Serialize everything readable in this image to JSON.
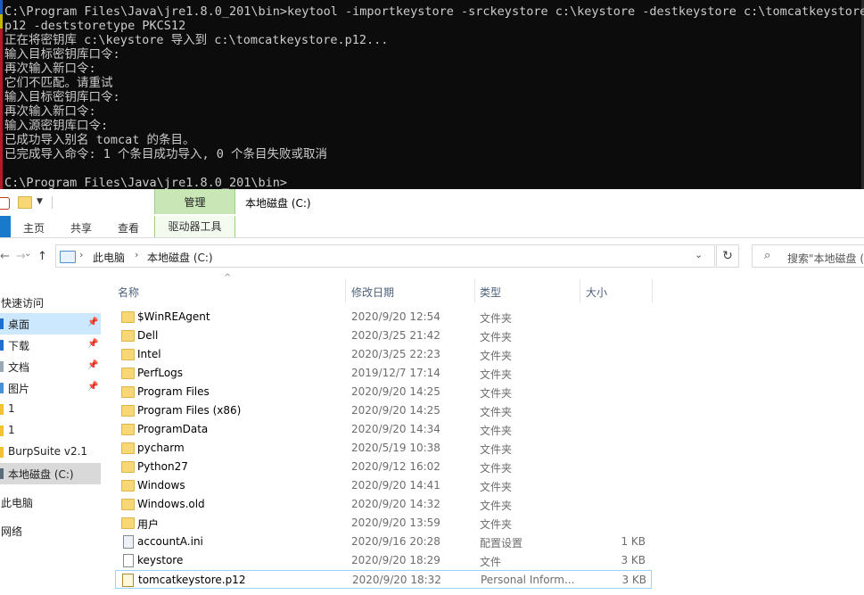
{
  "console": {
    "lines": [
      "C:\\Program Files\\Java\\jre1.8.0_201\\bin>keytool -importkeystore -srckeystore c:\\keystore -destkeystore c:\\tomcatkeystore.",
      "p12 -deststoretype PKCS12",
      "正在将密钥库 c:\\keystore 导入到 c:\\tomcatkeystore.p12...",
      "输入目标密钥库口令:",
      "再次输入新口令:",
      "它们不匹配。请重试",
      "输入目标密钥库口令:",
      "再次输入新口令:",
      "输入源密钥库口令:",
      "已成功导入别名 tomcat 的条目。",
      "已完成导入命令: 1 个条目成功导入, 0 个条目失败或取消",
      "",
      "C:\\Program Files\\Java\\jre1.8.0_201\\bin>"
    ]
  },
  "explorer": {
    "context_tab": "管理",
    "window_title": "本地磁盘 (C:)",
    "ribbon_tabs": {
      "home": "主页",
      "share": "共享",
      "view": "查看",
      "drive_tools": "驱动器工具"
    },
    "nav": {
      "back": "←",
      "forward": "→",
      "recent": "⌄",
      "up": "↑",
      "refresh": "↻"
    },
    "address": {
      "chevron": "›",
      "crumbs": [
        "此电脑",
        "本地磁盘 (C:)"
      ],
      "dropdown": "⌄"
    },
    "search": {
      "icon": "⌕",
      "placeholder": "搜索\"本地磁盘 (C:)\""
    },
    "sidebar": [
      {
        "label": "快速访问"
      },
      {
        "label": "桌面",
        "pinned": true
      },
      {
        "label": "下载",
        "pinned": true
      },
      {
        "label": "文档",
        "pinned": true
      },
      {
        "label": "图片",
        "pinned": true
      },
      {
        "label": "1"
      },
      {
        "label": "1"
      },
      {
        "label": "BurpSuite v2.1"
      },
      {
        "label": "本地磁盘 (C:)"
      },
      {
        "label": "此电脑"
      },
      {
        "label": "网络"
      }
    ],
    "pin_glyph": "📌",
    "columns": {
      "name": "名称",
      "date": "修改日期",
      "type": "类型",
      "size": "大小",
      "sort_indicator": "^"
    },
    "files": [
      {
        "name": "$WinREAgent",
        "date": "2020/9/20 12:54",
        "type": "文件夹",
        "size": "",
        "icon": "folder-icon"
      },
      {
        "name": "Dell",
        "date": "2020/3/25 21:42",
        "type": "文件夹",
        "size": "",
        "icon": "folder-icon"
      },
      {
        "name": "Intel",
        "date": "2020/3/25 22:23",
        "type": "文件夹",
        "size": "",
        "icon": "folder-icon"
      },
      {
        "name": "PerfLogs",
        "date": "2019/12/7 17:14",
        "type": "文件夹",
        "size": "",
        "icon": "folder-icon"
      },
      {
        "name": "Program Files",
        "date": "2020/9/20 14:25",
        "type": "文件夹",
        "size": "",
        "icon": "folder-icon"
      },
      {
        "name": "Program Files (x86)",
        "date": "2020/9/20 14:25",
        "type": "文件夹",
        "size": "",
        "icon": "folder-icon"
      },
      {
        "name": "ProgramData",
        "date": "2020/9/20 14:34",
        "type": "文件夹",
        "size": "",
        "icon": "folder-icon"
      },
      {
        "name": "pycharm",
        "date": "2020/5/19 10:38",
        "type": "文件夹",
        "size": "",
        "icon": "folder-icon"
      },
      {
        "name": "Python27",
        "date": "2020/9/12 16:02",
        "type": "文件夹",
        "size": "",
        "icon": "folder-icon"
      },
      {
        "name": "Windows",
        "date": "2020/9/20 14:41",
        "type": "文件夹",
        "size": "",
        "icon": "folder-icon"
      },
      {
        "name": "Windows.old",
        "date": "2020/9/20 14:32",
        "type": "文件夹",
        "size": "",
        "icon": "folder-icon"
      },
      {
        "name": "用户",
        "date": "2020/9/20 13:59",
        "type": "文件夹",
        "size": "",
        "icon": "folder-icon"
      },
      {
        "name": "accountA.ini",
        "date": "2020/9/16 20:28",
        "type": "配置设置",
        "size": "1 KB",
        "icon": "settings-file-icon"
      },
      {
        "name": "keystore",
        "date": "2020/9/20 18:29",
        "type": "文件",
        "size": "3 KB",
        "icon": "file-icon"
      },
      {
        "name": "tomcatkeystore.p12",
        "date": "2020/9/20 18:32",
        "type": "Personal Inform...",
        "size": "3 KB",
        "icon": "certificate-file-icon",
        "selected": true
      }
    ]
  }
}
